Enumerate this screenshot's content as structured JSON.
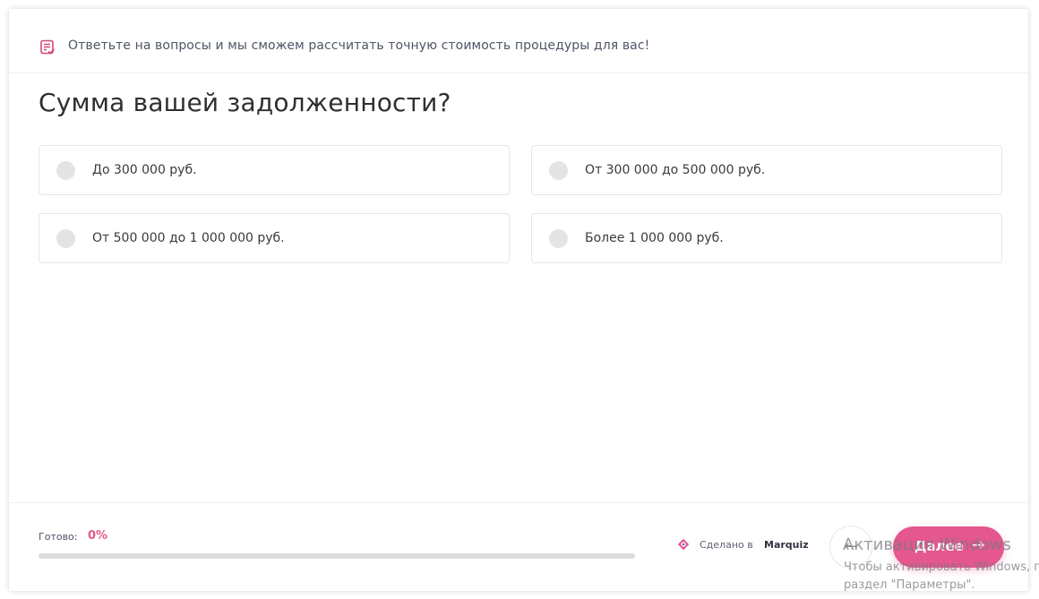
{
  "header": {
    "icon": "checklist-note-icon",
    "text": "Ответьте на вопросы и мы сможем рассчитать точную стоимость процедуры для вас!"
  },
  "question": "Сумма вашей задолженности?",
  "options": [
    {
      "label": "До 300 000 руб.",
      "selected": false
    },
    {
      "label": "От 300 000 до 500 000 руб.",
      "selected": false
    },
    {
      "label": "От 500 000 до 1 000 000 руб.",
      "selected": false
    },
    {
      "label": "Более 1 000 000 руб.",
      "selected": false
    }
  ],
  "footer": {
    "progress_label": "Готово:",
    "progress_value": "0%",
    "progress_fraction": 0,
    "made_in_text": "Сделано в",
    "made_in_brand": "Marquiz",
    "made_in_icon": "marquiz-logo-icon",
    "back_icon": "arrow-left-icon",
    "back_symbol": "←",
    "next_label": "Далее",
    "next_arrow": "→"
  },
  "watermark": {
    "title": "Активация Windows",
    "line1": "Чтобы активировать Windows, перейдите в",
    "line2": "раздел \"Параметры\"."
  },
  "colors": {
    "accent": "#e4578f",
    "radio": "#e4e4e6",
    "border": "#e6e6ea",
    "text": "#2f2f33"
  }
}
